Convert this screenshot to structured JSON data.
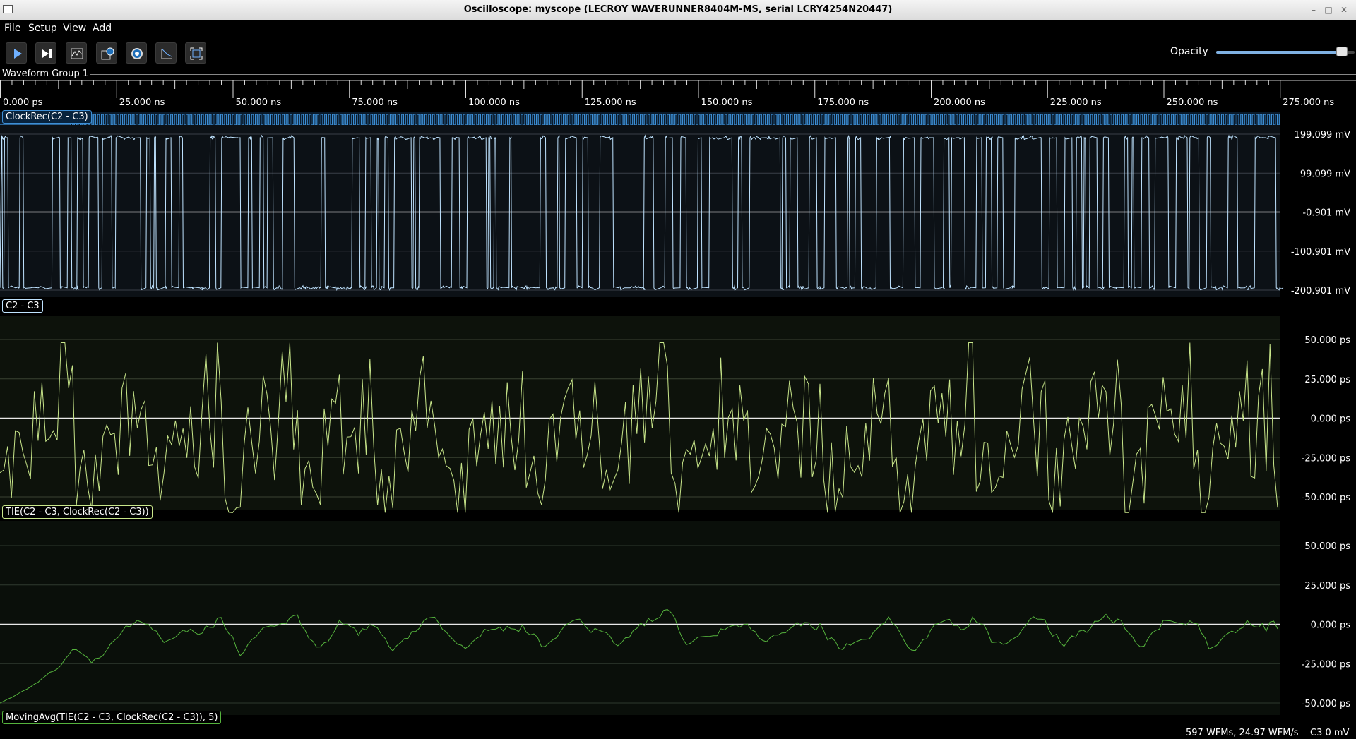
{
  "window": {
    "title": "Oscilloscope: myscope (LECROY WAVERUNNER8404M-MS, serial LCRY4254N20447)"
  },
  "menu": [
    "File",
    "Setup",
    "View",
    "Add"
  ],
  "toolbar": {
    "buttons": [
      {
        "name": "start-trigger-button",
        "icon": "play-icon"
      },
      {
        "name": "single-trigger-button",
        "icon": "step-forward-icon"
      },
      {
        "name": "waveform-button",
        "icon": "waveform-icon"
      },
      {
        "name": "history-button",
        "icon": "history-icon"
      },
      {
        "name": "refresh-button",
        "icon": "refresh-icon"
      },
      {
        "name": "measure-button",
        "icon": "measure-icon"
      },
      {
        "name": "fullscreen-button",
        "icon": "fullscreen-icon"
      }
    ],
    "opacity_label": "Opacity",
    "opacity_value": 0.91
  },
  "group": {
    "title": "Waveform Group 1"
  },
  "timeline": {
    "labels": [
      "0.000 ps",
      "25.000 ns",
      "50.000 ns",
      "75.000 ns",
      "100.000 ns",
      "125.000 ns",
      "150.000 ns",
      "175.000 ns",
      "200.000 ns",
      "225.000 ns",
      "250.000 ns",
      "275.000 ns"
    ],
    "range_ns": [
      0,
      276.0
    ]
  },
  "waveforms": [
    {
      "id": "clock",
      "label": "ClockRec(C2 - C3)",
      "color": "#3d8fd6"
    },
    {
      "id": "signal",
      "label": "C2 - C3",
      "color": "#bfe3ff",
      "y_labels": [
        "199.099 mV",
        "99.099 mV",
        "-0.901 mV",
        "-100.901 mV",
        "-200.901 mV"
      ],
      "y_values_mV": [
        199.099,
        99.099,
        -0.901,
        -100.901,
        -200.901
      ]
    },
    {
      "id": "tie",
      "label": "TIE(C2 - C3, ClockRec(C2 - C3))",
      "color": "#c8e68a",
      "y_labels": [
        "50.000 ps",
        "25.000 ps",
        "0.000 ps",
        "-25.000 ps",
        "-50.000 ps"
      ],
      "y_values_ps": [
        50,
        25,
        0,
        -25,
        -50
      ]
    },
    {
      "id": "movavg",
      "label": "MovingAvg(TIE(C2 - C3, ClockRec(C2 - C3)), 5)",
      "color": "#55b33d",
      "y_labels": [
        "50.000 ps",
        "25.000 ps",
        "0.000 ps",
        "-25.000 ps",
        "-50.000 ps"
      ],
      "y_values_ps": [
        50,
        25,
        0,
        -25,
        -50
      ]
    }
  ],
  "status": {
    "rate": "597 WFMs, 24.97 WFM/s",
    "channel": "C3 0 mV"
  }
}
